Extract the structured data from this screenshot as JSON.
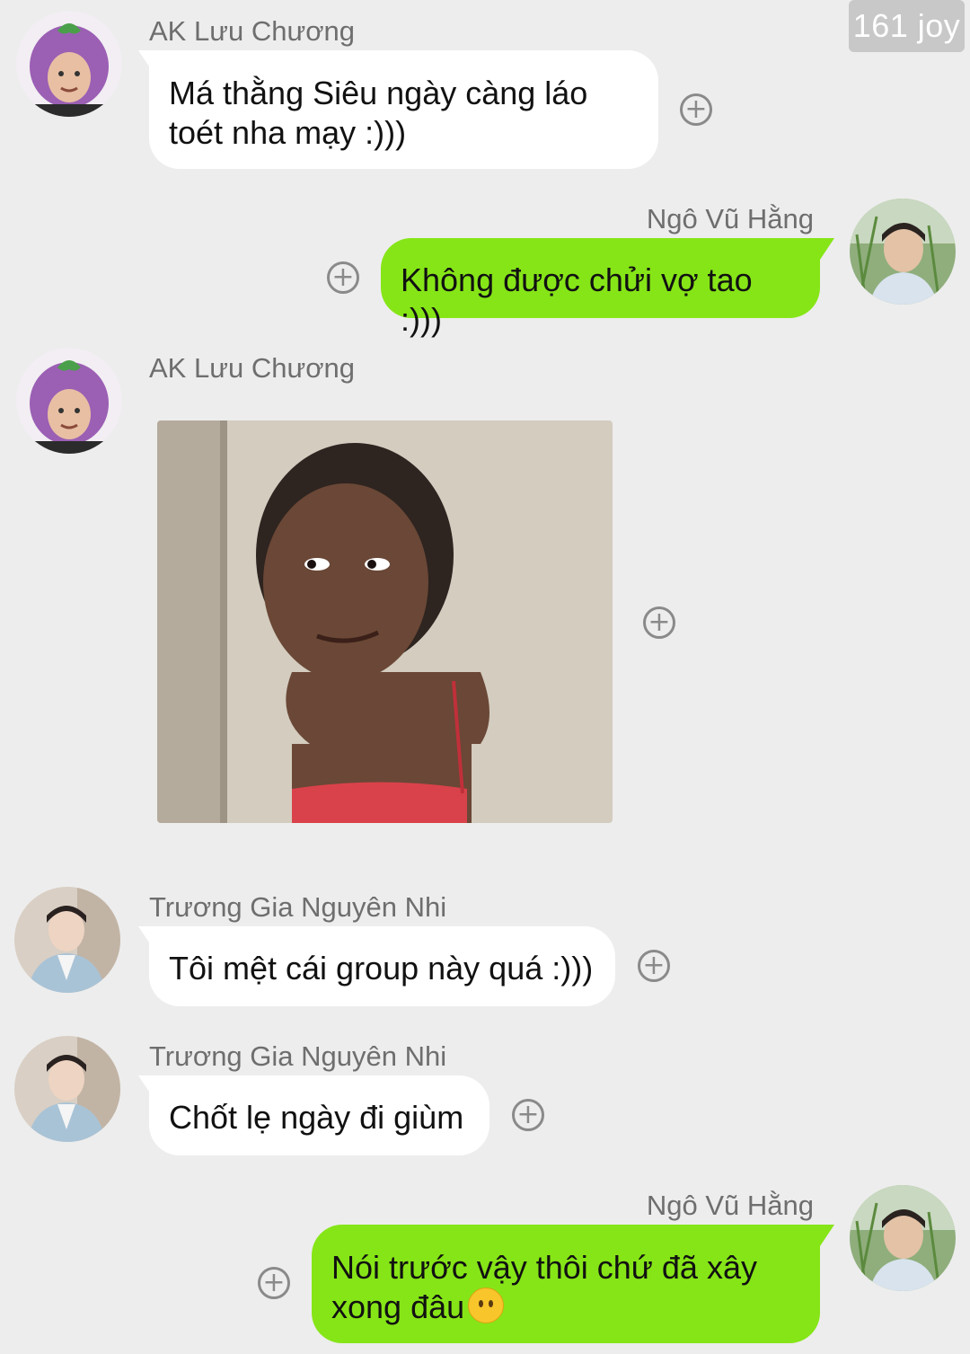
{
  "status": {
    "badge": "161 joy"
  },
  "colors": {
    "background": "#ededed",
    "incoming_bubble": "#ffffff",
    "outgoing_bubble": "#86e517",
    "name_text": "#6e6e6e"
  },
  "messages": [
    {
      "sender": "AK Lưu Chương",
      "avatar_icon": "eggplant-hat-avatar",
      "direction": "incoming",
      "text": "Má thằng Siêu ngày càng láo toét nha mạy :)))"
    },
    {
      "sender": "Ngô Vũ Hằng",
      "avatar_icon": "boy-in-grass-avatar",
      "direction": "outgoing",
      "text": "Không được chửi vợ tao :)))"
    },
    {
      "sender": "AK Lưu Chương",
      "avatar_icon": "eggplant-hat-avatar",
      "direction": "incoming",
      "type": "image",
      "image_icon": "girl-side-eye-photo"
    },
    {
      "sender": "Trương Gia Nguyên Nhi",
      "avatar_icon": "man-in-suit-avatar",
      "direction": "incoming",
      "text": "Tôi mệt cái group này quá :)))"
    },
    {
      "sender": "Trương Gia Nguyên Nhi",
      "avatar_icon": "man-in-suit-avatar",
      "direction": "incoming",
      "text": "Chốt lẹ ngày đi giùm"
    },
    {
      "sender": "Ngô Vũ Hằng",
      "avatar_icon": "boy-in-grass-avatar",
      "direction": "outgoing",
      "text": "Nói trước vậy thôi chứ đã xây xong đâu",
      "emoji": "neutral-face-emoji"
    }
  ],
  "actions": {
    "react_icon": "add-reaction-icon",
    "react_glyph": "+"
  }
}
